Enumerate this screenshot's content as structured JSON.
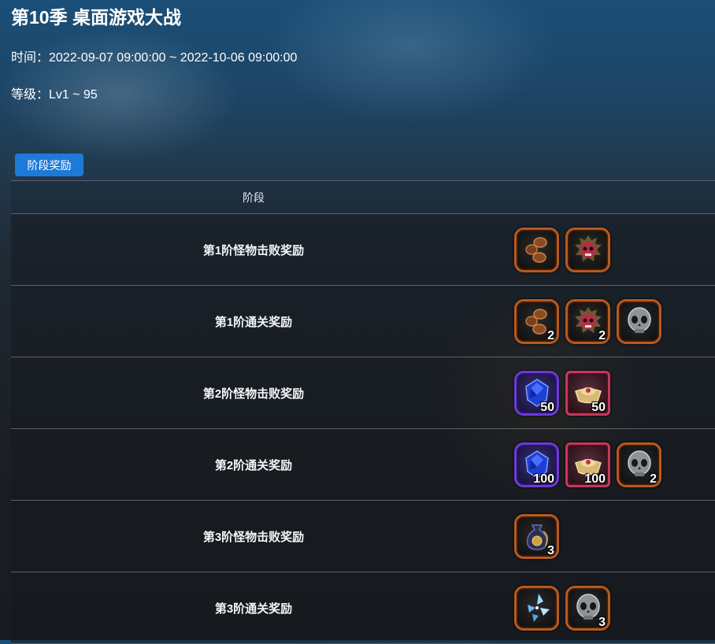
{
  "page": {
    "title": "第10季 桌面游戏大战",
    "time": "时间：2022-09-07 09:00:00 ~ 2022-10-06 09:00:00",
    "level": "等级：Lv1 ~ 95"
  },
  "tabs": [
    {
      "label": "阶段奖励",
      "active": true
    }
  ],
  "table": {
    "header": {
      "stage": "阶段"
    },
    "rows": [
      {
        "stage": "第1阶怪物击败奖励",
        "rewards": [
          {
            "icon": "coins-icon",
            "qty": ""
          },
          {
            "icon": "red-skull-icon",
            "qty": ""
          }
        ]
      },
      {
        "stage": "第1阶通关奖励",
        "rewards": [
          {
            "icon": "coins-icon",
            "qty": "2"
          },
          {
            "icon": "red-skull-icon",
            "qty": "2"
          },
          {
            "icon": "gray-skull-icon",
            "qty": ""
          }
        ]
      },
      {
        "stage": "第2阶怪物击败奖励",
        "rewards": [
          {
            "icon": "blue-gem-icon",
            "qty": "50"
          },
          {
            "icon": "gold-ingot-icon",
            "qty": "50"
          }
        ]
      },
      {
        "stage": "第2阶通关奖励",
        "rewards": [
          {
            "icon": "blue-gem-icon",
            "qty": "100"
          },
          {
            "icon": "gold-ingot-icon",
            "qty": "100"
          },
          {
            "icon": "gray-skull-icon",
            "qty": "2"
          }
        ]
      },
      {
        "stage": "第3阶怪物击败奖励",
        "rewards": [
          {
            "icon": "coin-pouch-icon",
            "qty": "3"
          }
        ]
      },
      {
        "stage": "第3阶通关奖励",
        "rewards": [
          {
            "icon": "crystal-shards-icon",
            "qty": ""
          },
          {
            "icon": "gray-skull-icon",
            "qty": "3"
          }
        ]
      }
    ]
  },
  "colors": {
    "accent": "#1e7ad9",
    "frame_common": "#b65a21",
    "frame_epic": "#6b3bd6",
    "frame_rare": "#c23a5b"
  }
}
